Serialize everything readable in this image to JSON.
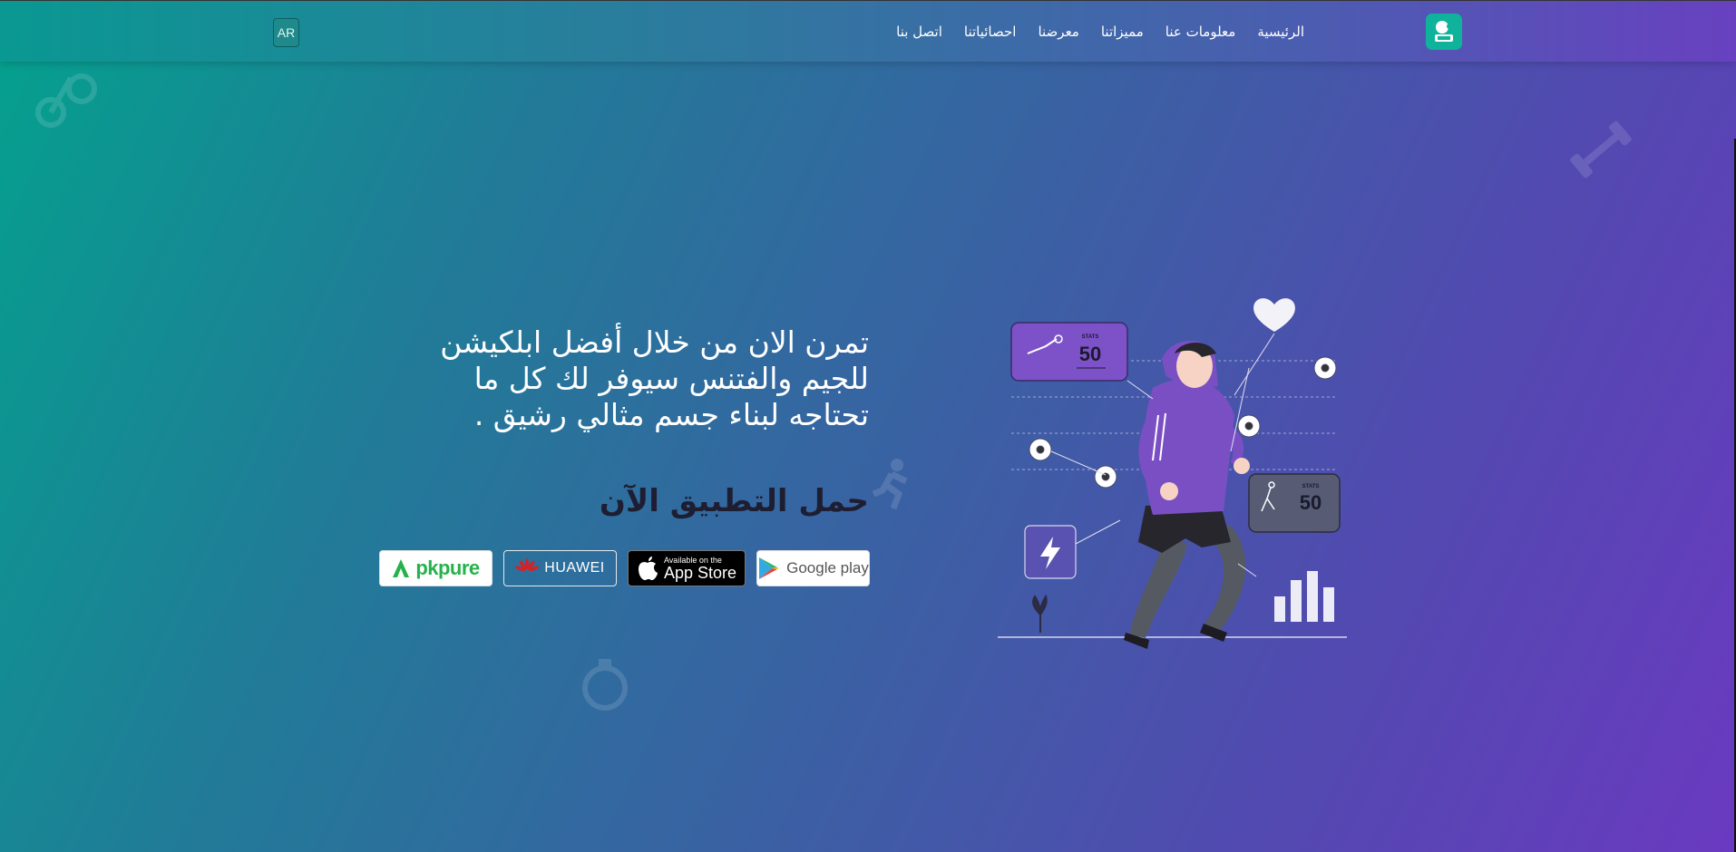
{
  "navbar": {
    "logo_icon": "app-logo-icon",
    "links": [
      {
        "label": "الرئيسية"
      },
      {
        "label": "معلومات عنا"
      },
      {
        "label": "مميزاتنا"
      },
      {
        "label": "معرضنا"
      },
      {
        "label": "احصائياتنا"
      },
      {
        "label": "اتصل بنا"
      }
    ],
    "language_button": "AR"
  },
  "hero": {
    "headline": "تمرن الان من خلال أفضل ابلكيشن للجيم والفتنس سيوفر لك كل ما تحتاجه لبناء جسم مثالي رشيق .",
    "download_title": "حمل التطبيق الآن",
    "stores": {
      "google_play": "Google play",
      "app_store_small": "Available on the",
      "app_store_big": "App Store",
      "huawei": "HUAWEI",
      "apkpure": "pkpure"
    }
  },
  "illustration": {
    "stats_top_label": "STATS",
    "stats_top_value": "50",
    "stats_bottom_label": "STATS",
    "stats_bottom_value": "50"
  },
  "colors": {
    "gradient_start": "#04a18e",
    "gradient_end": "#6a3ac0",
    "accent_purple": "#7d52c8",
    "logo_bg": "#0fb39c",
    "download_title": "#1e1e32"
  }
}
